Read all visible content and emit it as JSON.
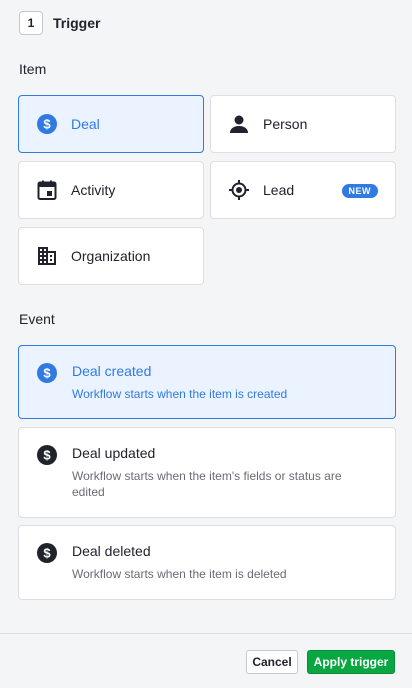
{
  "header": {
    "step": "1",
    "title": "Trigger"
  },
  "item_section": {
    "label": "Item",
    "items": [
      {
        "label": "Deal",
        "icon": "dollar-circle-icon",
        "selected": true
      },
      {
        "label": "Person",
        "icon": "person-icon",
        "selected": false
      },
      {
        "label": "Activity",
        "icon": "calendar-icon",
        "selected": false
      },
      {
        "label": "Lead",
        "icon": "target-icon",
        "selected": false,
        "badge": "NEW"
      },
      {
        "label": "Organization",
        "icon": "building-icon",
        "selected": false
      }
    ]
  },
  "event_section": {
    "label": "Event",
    "events": [
      {
        "title": "Deal created",
        "description": "Workflow starts when the item is created",
        "selected": true
      },
      {
        "title": "Deal updated",
        "description": "Workflow starts when the item's fields or status are edited",
        "selected": false
      },
      {
        "title": "Deal deleted",
        "description": "Workflow starts when the item is deleted",
        "selected": false
      }
    ]
  },
  "footer": {
    "cancel_label": "Cancel",
    "apply_label": "Apply trigger"
  },
  "colors": {
    "accent": "#317ae2",
    "selected_bg": "#eaf3ff",
    "apply_green": "#08a742"
  }
}
